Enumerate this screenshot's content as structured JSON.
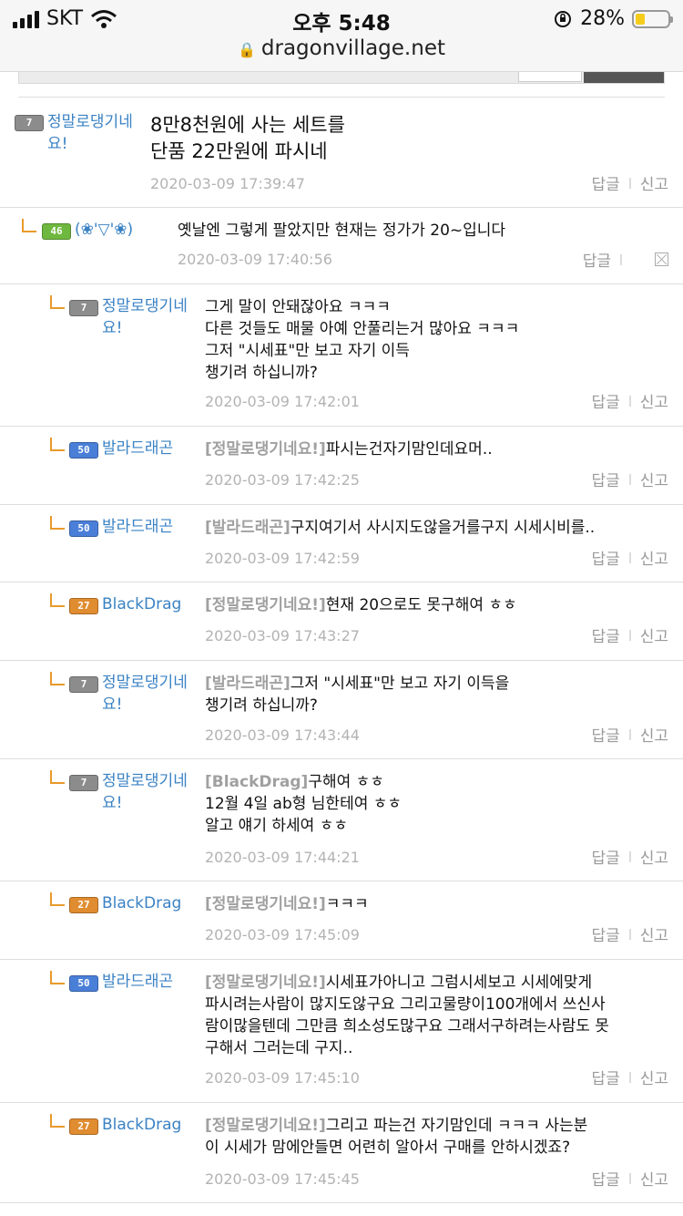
{
  "status_bar": {
    "carrier": "SKT",
    "time": "오후 5:48",
    "battery": "28%",
    "battery_level": 0.28
  },
  "browser": {
    "url": "dragonvillage.net"
  },
  "colors": {
    "link": "#3a82c4",
    "reply_mark": "#e89a2b",
    "timestamp": "#b3b3b3"
  },
  "actions": {
    "reply": "답글",
    "report": "신고"
  },
  "comments": [
    {
      "level": "7",
      "badge_color": "gray",
      "nick": "정말로댕기네요!",
      "lines": [
        "8만8천원에 사는 세트를",
        "단품 22만원에 파시네"
      ],
      "ref": "",
      "time": "2020-03-09 17:39:47"
    },
    {
      "level": "46",
      "badge_color": "green",
      "nick": "(❀'▽'❀)",
      "lines": [
        "옛날엔 그렇게 팔았지만 현재는 정가가 20~입니다"
      ],
      "ref": "",
      "time": "2020-03-09 17:40:56"
    },
    {
      "level": "7",
      "badge_color": "gray",
      "nick": "정말로댕기네요!",
      "lines": [
        "그게 말이 안돼잖아요 ㅋㅋㅋ",
        "다른 것들도 매물 아예 안풀리는거 많아요 ㅋㅋㅋ",
        "그저 \"시세표\"만 보고 자기 이득",
        "챙기려 하십니까?"
      ],
      "ref": "",
      "time": "2020-03-09 17:42:01"
    },
    {
      "level": "50",
      "badge_color": "blue",
      "nick": "발라드래곤",
      "ref": "[정말로댕기네요!]",
      "lines": [
        "파시는건자기맘인데요머.."
      ],
      "time": "2020-03-09 17:42:25"
    },
    {
      "level": "50",
      "badge_color": "blue",
      "nick": "발라드래곤",
      "ref": "[발라드래곤]",
      "lines": [
        "구지여기서 사시지도않을거를구지 시세시비를.."
      ],
      "time": "2020-03-09 17:42:59"
    },
    {
      "level": "27",
      "badge_color": "orange",
      "nick": "BlackDrag",
      "ref": "[정말로댕기네요!]",
      "lines": [
        "현재 20으로도 못구해여 ㅎㅎ"
      ],
      "time": "2020-03-09 17:43:27"
    },
    {
      "level": "7",
      "badge_color": "gray",
      "nick": "정말로댕기네요!",
      "ref": "[발라드래곤]",
      "lines": [
        "그저 \"시세표\"만 보고 자기 이득을",
        "챙기려 하십니까?"
      ],
      "time": "2020-03-09 17:43:44"
    },
    {
      "level": "7",
      "badge_color": "gray",
      "nick": "정말로댕기네요!",
      "ref": "[BlackDrag]",
      "lines": [
        "구해여 ㅎㅎ",
        "12월 4일 ab형 님한테여 ㅎㅎ",
        "알고 얘기 하세여 ㅎㅎ"
      ],
      "time": "2020-03-09 17:44:21"
    },
    {
      "level": "27",
      "badge_color": "orange",
      "nick": "BlackDrag",
      "ref": "[정말로댕기네요!]",
      "lines": [
        "ㅋㅋㅋ"
      ],
      "time": "2020-03-09 17:45:09"
    },
    {
      "level": "50",
      "badge_color": "blue",
      "nick": "발라드래곤",
      "ref": "[정말로댕기네요!]",
      "lines": [
        "시세표가아니고 그럼시세보고 시세에맞게",
        "파시려는사람이 많지도않구요 그리고물량이100개에서 쓰신사",
        "람이많을텐데 그만큼 희소성도많구요 그래서구하려는사람도 못",
        "구해서 그러는데 구지.."
      ],
      "time": "2020-03-09 17:45:10"
    },
    {
      "level": "27",
      "badge_color": "orange",
      "nick": "BlackDrag",
      "ref": "[정말로댕기네요!]",
      "lines": [
        "그리고 파는건 자기맘인데 ㅋㅋㅋ 사는분",
        "이 시세가 맘에안들면 어련히 알아서 구매를 안하시겠죠?"
      ],
      "time": "2020-03-09 17:45:45"
    }
  ]
}
